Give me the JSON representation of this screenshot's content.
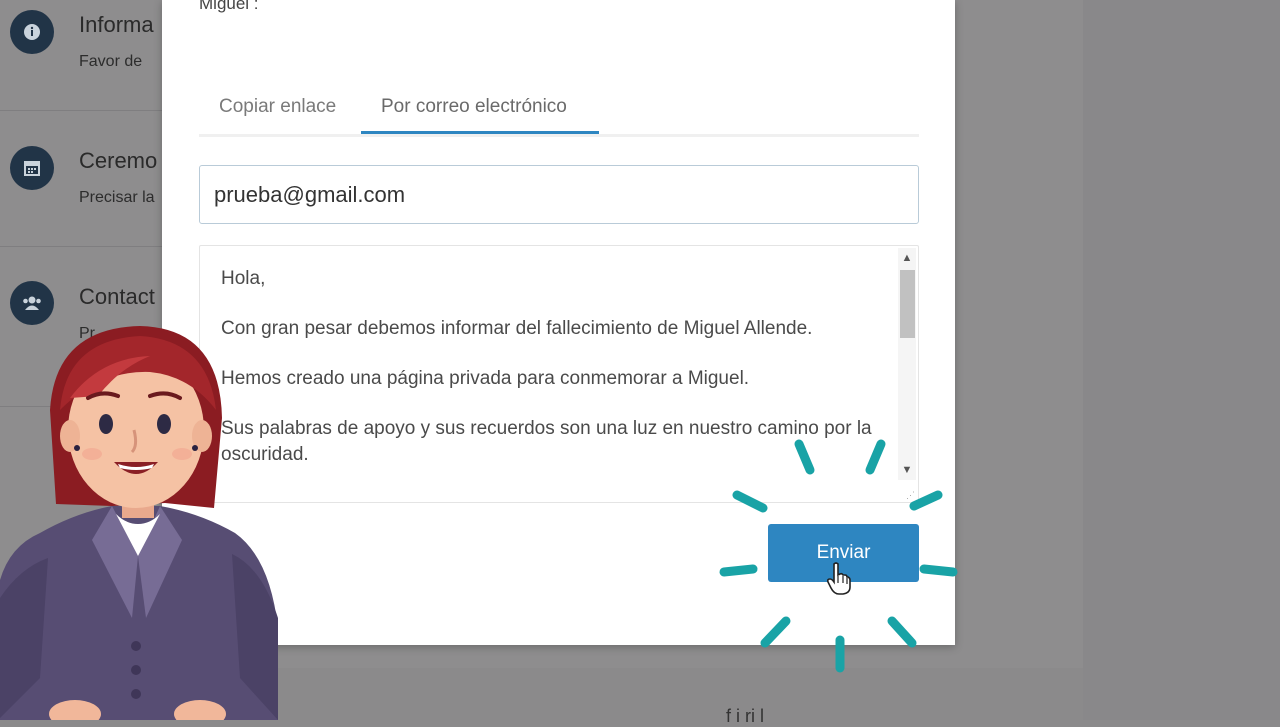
{
  "background": {
    "items": [
      {
        "icon": "info-icon",
        "title": "Informa",
        "subtitle": "Favor de"
      },
      {
        "icon": "calendar-icon",
        "title": "Ceremo",
        "subtitle": "Precisar la"
      },
      {
        "icon": "users-icon",
        "title": "Contact",
        "subtitle": "Pr"
      }
    ],
    "bottom_text": "f    i        ri    l"
  },
  "modal": {
    "heading": "Miguel :",
    "tabs": [
      {
        "label": "Copiar enlace",
        "active": false
      },
      {
        "label": "Por correo electrónico",
        "active": true
      }
    ],
    "email_value": "prueba@gmail.com",
    "message": {
      "greeting": "Hola,",
      "p1": "Con gran pesar debemos informar del fallecimiento de Miguel Allende.",
      "p2": "Hemos creado una página privada para conmemorar a Miguel.",
      "p3": "Sus palabras de apoyo y sus recuerdos son una luz en nuestro camino por la oscuridad."
    },
    "send_label": "Enviar"
  },
  "colors": {
    "accent": "#2e86c1",
    "ray": "#19a3a6",
    "icon_circle": "#213447"
  }
}
